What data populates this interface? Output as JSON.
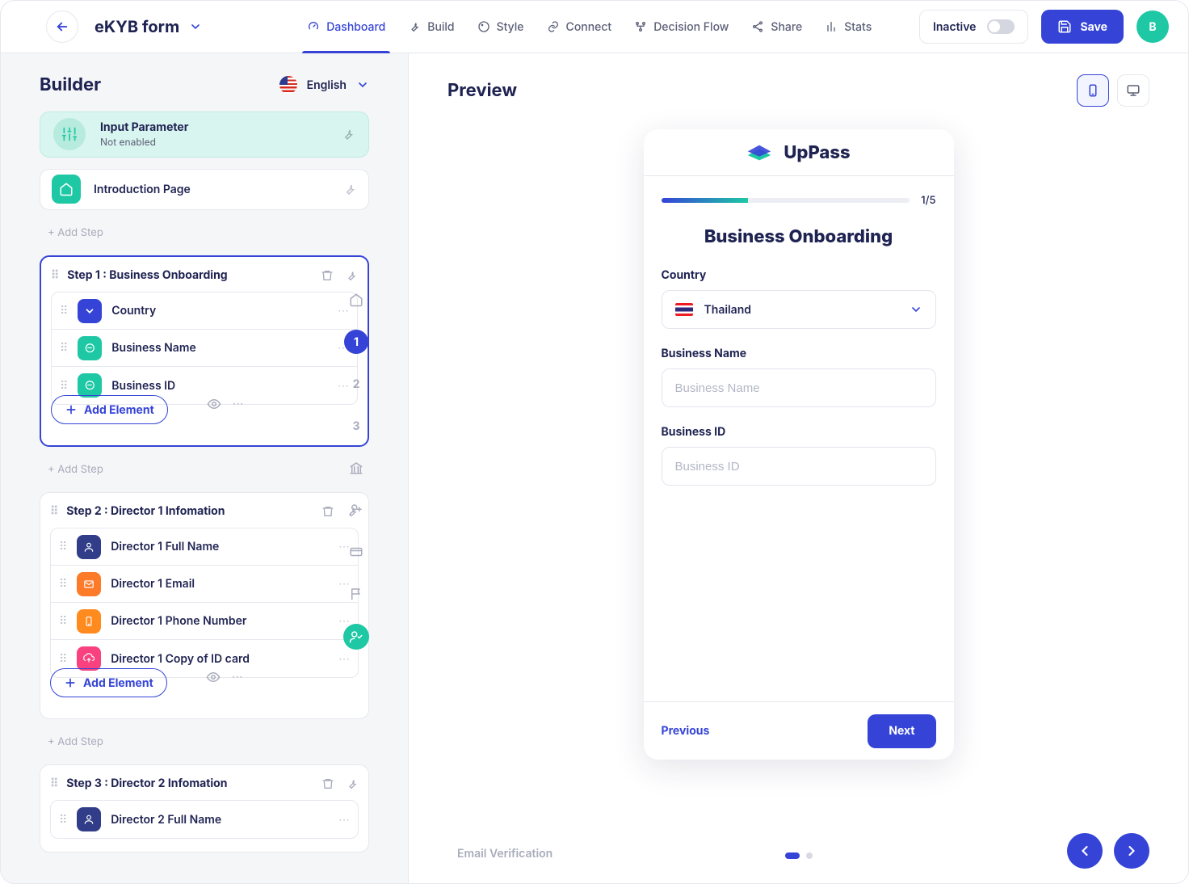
{
  "header": {
    "form_name": "eKYB form",
    "nav_items": [
      {
        "label": "Dashboard",
        "active": true
      },
      {
        "label": "Build"
      },
      {
        "label": "Style"
      },
      {
        "label": "Connect"
      },
      {
        "label": "Decision Flow"
      },
      {
        "label": "Share"
      },
      {
        "label": "Stats"
      }
    ],
    "status_label": "Inactive",
    "save_label": "Save",
    "avatar_letter": "B"
  },
  "builder": {
    "title": "Builder",
    "language": "English",
    "input_parameter": {
      "title": "Input Parameter",
      "subtitle": "Not enabled"
    },
    "introduction_label": "Introduction Page",
    "add_step_label": "+ Add Step",
    "add_element_label": "Add Element",
    "steps": [
      {
        "title": "Step 1 : Business Onboarding",
        "selected": true,
        "elements": [
          {
            "label": "Country",
            "icon": "chevdown",
            "color": "ic-blue"
          },
          {
            "label": "Business Name",
            "icon": "chat",
            "color": "ic-teal"
          },
          {
            "label": "Business ID",
            "icon": "chat",
            "color": "ic-teal"
          }
        ]
      },
      {
        "title": "Step 2 : Director 1 Infomation",
        "elements": [
          {
            "label": "Director 1 Full Name",
            "icon": "user",
            "color": "ic-nav"
          },
          {
            "label": "Director 1 Email",
            "icon": "mail",
            "color": "ic-orange"
          },
          {
            "label": "Director 1 Phone Number",
            "icon": "phone",
            "color": "ic-orange2"
          },
          {
            "label": "Director 1 Copy of ID card",
            "icon": "upload",
            "color": "ic-pink"
          }
        ]
      },
      {
        "title": "Step 3 : Director 2 Infomation",
        "elements": [
          {
            "label": "Director 2 Full Name",
            "icon": "user",
            "color": "ic-nav"
          }
        ]
      }
    ],
    "mini_nav": [
      "home",
      "1",
      "2",
      "3",
      "bank",
      "user-add",
      "card",
      "flag",
      "user-check"
    ]
  },
  "preview": {
    "title": "Preview",
    "brand": "UpPass",
    "progress": {
      "current": 1,
      "total": 5,
      "display": "1/5"
    },
    "page_title": "Business Onboarding",
    "country_label": "Country",
    "country_value": "Thailand",
    "bizname_label": "Business Name",
    "bizname_placeholder": "Business Name",
    "bizid_label": "Business ID",
    "bizid_placeholder": "Business ID",
    "prev_label": "Previous",
    "next_label": "Next",
    "bottom_caption": "Email Verification"
  }
}
